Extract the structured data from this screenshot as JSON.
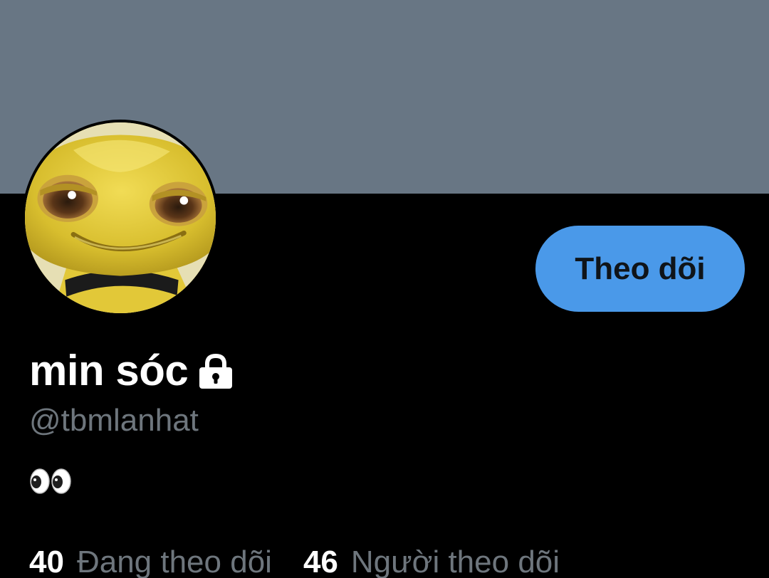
{
  "profile": {
    "display_name": "min sóc",
    "handle": "@tbmlanhat",
    "bio": "👀",
    "protected_icon": "lock-icon",
    "avatar": "bee-face-avatar"
  },
  "actions": {
    "follow_label": "Theo dõi"
  },
  "stats": {
    "following_count": "40",
    "following_label": "Đang theo dõi",
    "followers_count": "46",
    "followers_label": "Người theo dõi"
  },
  "colors": {
    "banner": "#687684",
    "background": "#000000",
    "follow_button": "#4a99e9",
    "secondary_text": "#6e767d",
    "primary_text": "#ffffff"
  }
}
